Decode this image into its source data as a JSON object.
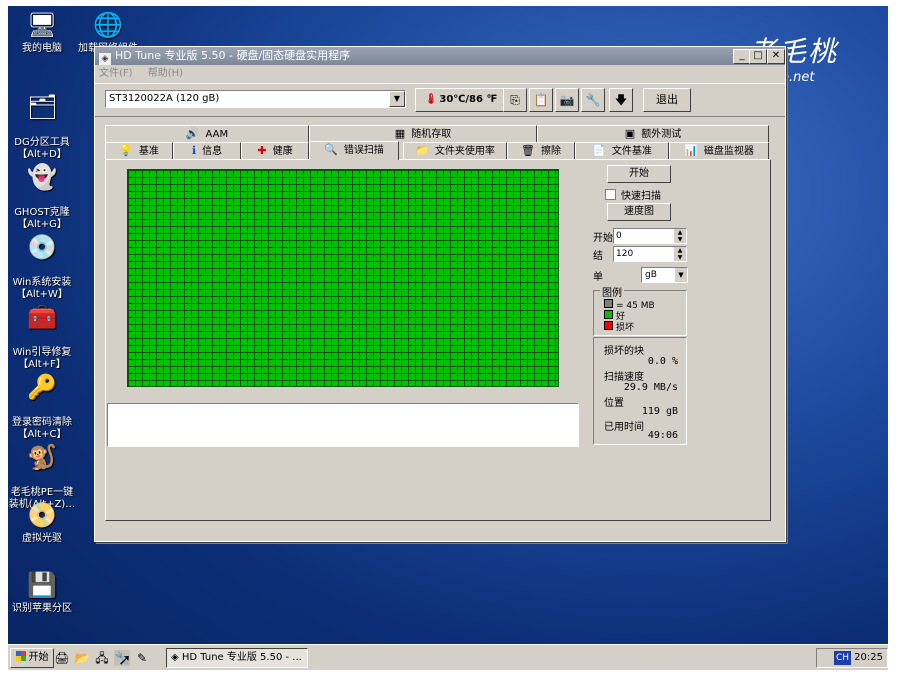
{
  "desktop": {
    "icons": [
      {
        "name": "my-computer",
        "label": "我的电脑",
        "glyph": "🖥"
      },
      {
        "name": "network",
        "label": "加载网络组件",
        "glyph": "🌐"
      },
      {
        "name": "dg-partition",
        "label": "DG分区工具\n【Alt+D】",
        "glyph": "🗂"
      },
      {
        "name": "ghost",
        "label": "GHOST克隆\n【Alt+G】",
        "glyph": "👻"
      },
      {
        "name": "win-install",
        "label": "Win系统安装\n【Alt+W】",
        "glyph": "💿"
      },
      {
        "name": "win-boot-repair",
        "label": "Win引导修复\n【Alt+F】",
        "glyph": "🧰"
      },
      {
        "name": "password-clear",
        "label": "登录密码清除\n【Alt+C】",
        "glyph": "🔑"
      },
      {
        "name": "laomaotao-pe",
        "label": "老毛桃PE一键\n装机(Alt+Z)…",
        "glyph": "🐒"
      },
      {
        "name": "virtual-drive",
        "label": "虚拟光驱",
        "glyph": "📀"
      },
      {
        "name": "apple-partition",
        "label": "识别苹果分区",
        "glyph": "💾"
      }
    ],
    "brand": {
      "title": "老毛桃",
      "url": "otao.net"
    }
  },
  "window": {
    "title": "HD Tune 专业版 5.50 - 硬盘/固态硬盘实用程序",
    "menu": [
      "文件(F)",
      "帮助(H)"
    ],
    "drive": "ST3120022A (120 gB)",
    "temperature": "30℃/86 ℉",
    "exit_label": "退出",
    "tabs_top": [
      {
        "icon": "🔊",
        "label": "AAM"
      },
      {
        "icon": "▦",
        "label": "随机存取"
      },
      {
        "icon": "▣",
        "label": "额外测试"
      }
    ],
    "tabs_bottom": [
      {
        "icon": "💡",
        "label": "基准"
      },
      {
        "icon": "ℹ",
        "label": "信息"
      },
      {
        "icon": "✚",
        "label": "健康"
      },
      {
        "icon": "🔍",
        "label": "错误扫描"
      },
      {
        "icon": "📁",
        "label": "文件夹使用率"
      },
      {
        "icon": "🗑",
        "label": "擦除"
      },
      {
        "icon": "📄",
        "label": "文件基准"
      },
      {
        "icon": "📊",
        "label": "磁盘监视器"
      }
    ],
    "scan": {
      "start_button": "开始",
      "quick_scan": "快速扫描",
      "speed_map": "速度图",
      "start_label": "开始",
      "start_value": "0",
      "end_label": "结",
      "end_value": "120",
      "unit_label": "单",
      "unit_value": "gB",
      "legend_title": "图例",
      "legend_block": "= 45 MB",
      "legend_good": "好",
      "legend_bad": "损坏",
      "damaged_label": "损坏的块",
      "damaged_value": "0.0 %",
      "speed_label": "扫描速度",
      "speed_value": "29.9 MB/s",
      "position_label": "位置",
      "position_value": "119 gB",
      "elapsed_label": "已用时间",
      "elapsed_value": "49:06"
    }
  },
  "taskbar": {
    "start": "开始",
    "task": "HD Tune 专业版 5.50 - ...",
    "ime": "CH",
    "clock": "20:25"
  },
  "colors": {
    "good": "#00c200",
    "bad": "#ff0000",
    "grid_line": "#005800"
  }
}
